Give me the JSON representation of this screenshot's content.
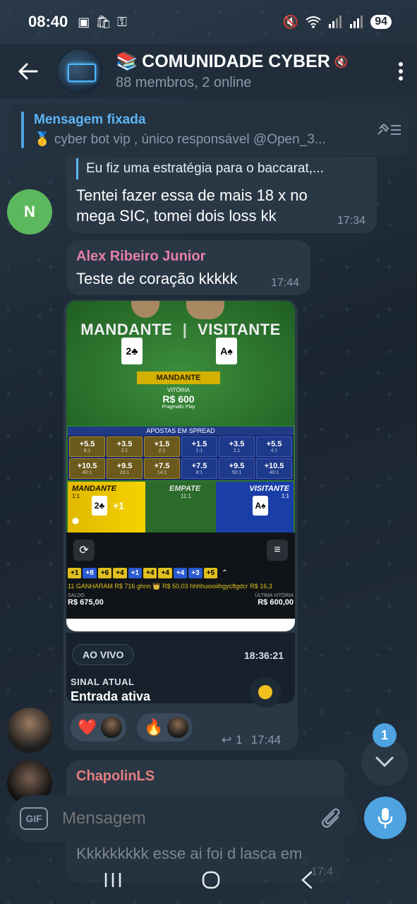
{
  "status_bar": {
    "time": "08:40",
    "battery": "94",
    "left_icons": [
      "screenshot-icon",
      "shop-icon",
      "vpn-icon"
    ],
    "right_icons": [
      "mute-icon",
      "wifi-icon",
      "signal-icon",
      "signal-icon"
    ]
  },
  "header": {
    "title_emoji": "📚",
    "title": "COMUNIDADE CYBER",
    "subtitle": "88 membros, 2 online"
  },
  "pinned": {
    "title": "Mensagem fixada",
    "body": "🥇 cyber bot vip , único responsável @Open_3..."
  },
  "messages": [
    {
      "avatar_letter": "N",
      "avatar_color": "#4caf50",
      "reply_preview": "Eu fiz uma estratégia para o baccarat,...",
      "text": "Tentei fazer essa de mais 18 x no mega SIC, tomei dois loss kk",
      "time": "17:34"
    },
    {
      "sender": "Alex Ribeiro Junior",
      "sender_color": "#e57fa6",
      "text": "Teste de coração kkkkk",
      "time": "17:44"
    },
    {
      "game": {
        "title_left": "MANDANTE",
        "title_right": "VISITANTE",
        "card_left": "2♣",
        "card_right": "A♠",
        "result_head": "MANDANTE",
        "result_label": "VITÓRIA",
        "result_value": "R$ 600",
        "provider": "Pragmatic Play",
        "spread_title": "APOSTAS EM SPREAD",
        "spread_row1": [
          {
            "v": "+5.5",
            "o": "8:1"
          },
          {
            "v": "+3.5",
            "o": "2:1"
          },
          {
            "v": "+1.5",
            "o": "2:1"
          },
          {
            "v": "+1.5",
            "o": "1:1"
          },
          {
            "v": "+3.5",
            "o": "2:1"
          },
          {
            "v": "+5.5",
            "o": "4:1"
          }
        ],
        "spread_row2": [
          {
            "v": "+10.5",
            "o": "40:1"
          },
          {
            "v": "+9.5",
            "o": "20:1"
          },
          {
            "v": "+7.5",
            "o": "14:1"
          },
          {
            "v": "+7.5",
            "o": "8:1"
          },
          {
            "v": "+9.5",
            "o": "50:1"
          },
          {
            "v": "+10.5",
            "o": "40:1"
          }
        ],
        "bet_m": "MANDANTE",
        "bet_m_odds": "1:1",
        "bet_m_plus": "+1",
        "bet_e": "EMPATE",
        "bet_e_odds": "11:1",
        "bet_v": "VISITANTE",
        "bet_v_odds": "1:1",
        "chips": [
          "+1",
          "+8",
          "+6",
          "+4",
          "+1",
          "+4",
          "+4",
          "+4",
          "+3",
          "+5"
        ],
        "ticker": "11 GANHARAM R$ 716   ghnn 👑   R$ 50,03 hhhhuiooiihgycftgdcr  R$ 16,3",
        "saldo_label": "SALDO",
        "saldo": "R$ 675,00",
        "ultima_label": "ÚLTIMA VITÓRIA",
        "ultima": "R$ 600,00"
      },
      "live": {
        "badge": "AO VIVO",
        "time": "18:36:21",
        "signal_label": "SINAL ATUAL",
        "signal_value": "Entrada ativa"
      },
      "reactions": [
        "❤️",
        "🔥"
      ],
      "replies": "1",
      "time": "17:44"
    },
    {
      "sender": "ChapolinLS",
      "sender_color": "#e57f7f",
      "text": "Kkkkkkkkk esse ai foi d lasca em",
      "time": "17:4"
    }
  ],
  "scroll_badge": "1",
  "composer": {
    "gif_label": "GIF",
    "placeholder": "Mensagem"
  }
}
